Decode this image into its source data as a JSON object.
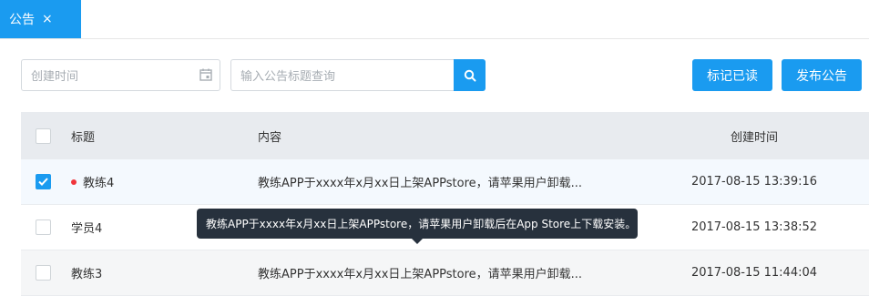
{
  "tabs": [
    {
      "label": "公告",
      "close": "×"
    }
  ],
  "filters": {
    "date_placeholder": "创建时间",
    "search_placeholder": "输入公告标题查询"
  },
  "buttons": {
    "mark_read": "标记已读",
    "publish": "发布公告"
  },
  "table": {
    "headers": {
      "title": "标题",
      "content": "内容",
      "created": "创建时间"
    },
    "rows": [
      {
        "title": "教练4",
        "content": "教练APP于xxxx年x月xx日上架APPstore，请苹果用户卸载...",
        "created": "2017-08-15 13:39:16",
        "checked": true,
        "unread": true
      },
      {
        "title": "学员4",
        "content": "",
        "created": "2017-08-15 13:38:52",
        "checked": false,
        "unread": false
      },
      {
        "title": "教练3",
        "content": "教练APP于xxxx年x月xx日上架APPstore，请苹果用户卸载...",
        "created": "2017-08-15 11:44:04",
        "checked": false,
        "unread": false
      }
    ]
  },
  "tooltip": {
    "text": "教练APP于xxxx年x月xx日上架APPstore，请苹果用户卸载后在App Store上下载安装。"
  },
  "colors": {
    "accent": "#1a9bf0",
    "unread_dot": "#f0353b",
    "tooltip_bg": "#27313d"
  }
}
